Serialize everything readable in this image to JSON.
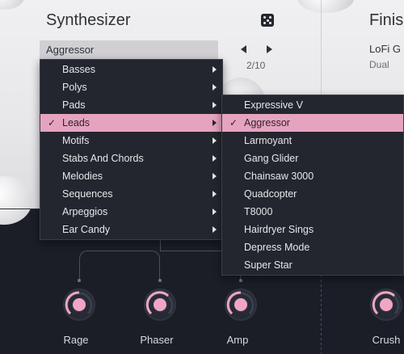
{
  "colors": {
    "accent": "#e6a3bf",
    "background_dark": "#1b1e27",
    "panel_light": "#ececef",
    "knob_core": "#f1a5c4"
  },
  "synth": {
    "title": "Synthesizer",
    "preset_name": "Aggressor",
    "preset_counter": "2/10",
    "random_icon": "dice-icon"
  },
  "finish": {
    "title": "Finis",
    "preset": "LoFi G",
    "mode": "Dual"
  },
  "menu_categories": [
    {
      "label": "Basses"
    },
    {
      "label": "Polys"
    },
    {
      "label": "Pads"
    },
    {
      "label": "Leads",
      "selected": true
    },
    {
      "label": "Motifs"
    },
    {
      "label": "Stabs And Chords"
    },
    {
      "label": "Melodies"
    },
    {
      "label": "Sequences"
    },
    {
      "label": "Arpeggios"
    },
    {
      "label": "Ear Candy"
    }
  ],
  "menu_presets": [
    {
      "label": "Expressive V"
    },
    {
      "label": "Aggressor",
      "selected": true
    },
    {
      "label": "Larmoyant"
    },
    {
      "label": "Gang Glider"
    },
    {
      "label": "Chainsaw 3000"
    },
    {
      "label": "Quadcopter"
    },
    {
      "label": "T8000"
    },
    {
      "label": "Hairdryer Sings"
    },
    {
      "label": "Depress Mode"
    },
    {
      "label": "Super Star"
    }
  ],
  "check_glyph": "✓",
  "knobs": [
    {
      "label": "Rage"
    },
    {
      "label": "Phaser"
    },
    {
      "label": "Amp"
    },
    {
      "label": "Crush"
    }
  ]
}
